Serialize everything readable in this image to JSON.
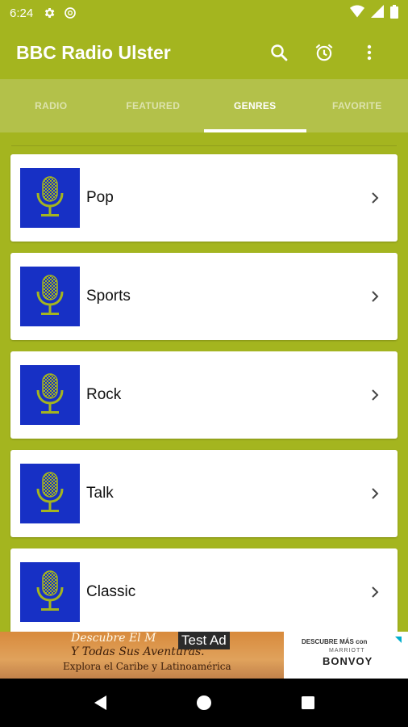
{
  "status_bar": {
    "time": "6:24"
  },
  "app": {
    "title": "BBC Radio Ulster"
  },
  "tabs": [
    {
      "label": "RADIO"
    },
    {
      "label": "FEATURED"
    },
    {
      "label": "GENRES"
    },
    {
      "label": "FAVORITE"
    }
  ],
  "active_tab": "GENRES",
  "genres": [
    {
      "label": "Pop"
    },
    {
      "label": "Sports"
    },
    {
      "label": "Rock"
    },
    {
      "label": "Talk"
    },
    {
      "label": "Classic"
    }
  ],
  "ad": {
    "badge": "Test Ad",
    "line1": "Descubre El M",
    "line2": "Y Todas Sus Aventuras.",
    "line3": "Explora el Caribe y Latinoamérica",
    "right_line1": "DESCUBRE MÁS con",
    "right_line2": "MARRIOTT",
    "right_line3": "BONVOY"
  },
  "colors": {
    "primary": "#a4b51f",
    "tab_bar": "#b3c14a",
    "thumb_bg": "#1730c5",
    "mic": "#a4b51f"
  },
  "icons": {
    "status": [
      "gear-icon",
      "do-not-disturb-icon",
      "wifi-icon",
      "signal-icon",
      "battery-icon"
    ],
    "actions": [
      "search-icon",
      "alarm-icon",
      "more-vert-icon"
    ],
    "nav": [
      "back-icon",
      "home-icon",
      "recents-icon"
    ]
  }
}
